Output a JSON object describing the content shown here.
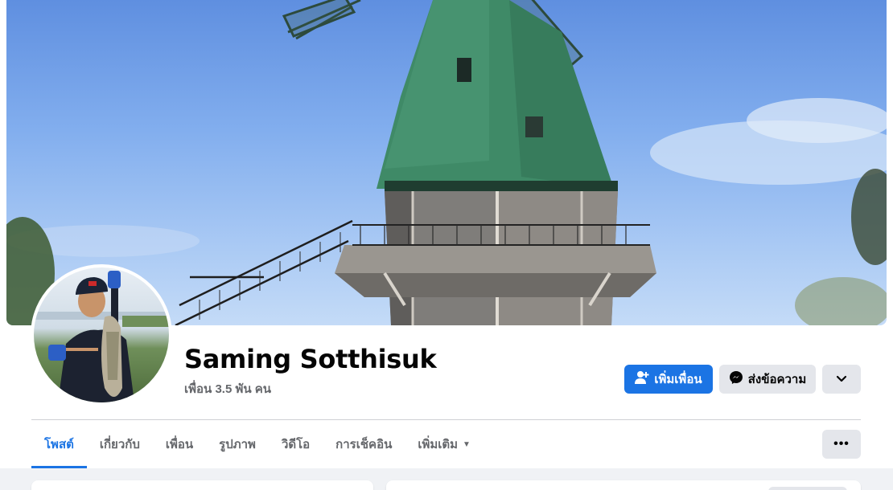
{
  "profile": {
    "name": "Saming Sotthisuk",
    "friends_text": "เพื่อน 3.5 พัน คน"
  },
  "actions": {
    "add_friend_label": "เพิ่มเพื่อน",
    "message_label": "ส่งข้อความ",
    "more_icon": "chevron-down-icon"
  },
  "tabs": [
    {
      "label": "โพสต์",
      "active": true
    },
    {
      "label": "เกี่ยวกับ",
      "active": false
    },
    {
      "label": "เพื่อน",
      "active": false
    },
    {
      "label": "รูปภาพ",
      "active": false
    },
    {
      "label": "วิดีโอ",
      "active": false
    },
    {
      "label": "การเช็คอิน",
      "active": false
    },
    {
      "label": "เพิ่มเติม",
      "active": false
    }
  ],
  "colors": {
    "primary": "#1b74e4",
    "secondary_button": "#e4e6eb",
    "text_primary": "#050505",
    "text_secondary": "#65676b",
    "page_background": "#f0f2f5"
  }
}
